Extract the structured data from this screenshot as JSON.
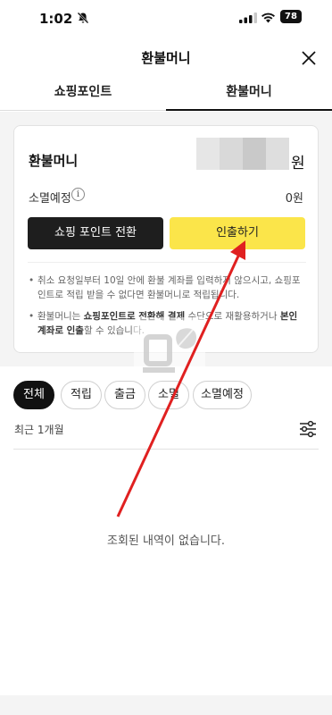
{
  "status_bar": {
    "time": "1:02",
    "battery": "78"
  },
  "header": {
    "title": "환불머니"
  },
  "tabs": [
    {
      "label": "쇼핑포인트",
      "selected": false
    },
    {
      "label": "환불머니",
      "selected": true
    }
  ],
  "balance": {
    "title": "환불머니",
    "unit": "원",
    "expire_label": "소멸예정",
    "expire_value": "0원"
  },
  "buttons": {
    "convert": "쇼핑 포인트 전환",
    "withdraw": "인출하기"
  },
  "notes": {
    "note1": "취소 요청일부터 10일 안에 환불 계좌를 입력하지 않으시고, 쇼핑포인트로 적립 받을 수 없다면 환불머니로 적립됩니다.",
    "note2_a": "환불머니는 ",
    "note2_b": "쇼핑포인트로 전환해 결제",
    "note2_c": " 수단으로 재활용하거나 ",
    "note2_d": "본인 계좌로 인출",
    "note2_e": "할 수 있습니다."
  },
  "filters": [
    {
      "label": "전체",
      "active": true
    },
    {
      "label": "적립",
      "active": false
    },
    {
      "label": "출금",
      "active": false
    },
    {
      "label": "소멸",
      "active": false
    },
    {
      "label": "소멸예정",
      "active": false
    }
  ],
  "period": "최근 1개월",
  "empty_message": "조회된 내역이 없습니다.",
  "icons": {
    "bell": "bell-slash-icon",
    "signal": "cellular-signal-icon",
    "wifi": "wifi-icon",
    "close": "close-icon",
    "info": "info-icon",
    "filter": "filter-sliders-icon"
  },
  "colors": {
    "accent_yellow": "#fbe54a",
    "dark_button": "#1e1e1e",
    "annotation_arrow": "#e02020",
    "background_gray": "#f4f4f4"
  }
}
